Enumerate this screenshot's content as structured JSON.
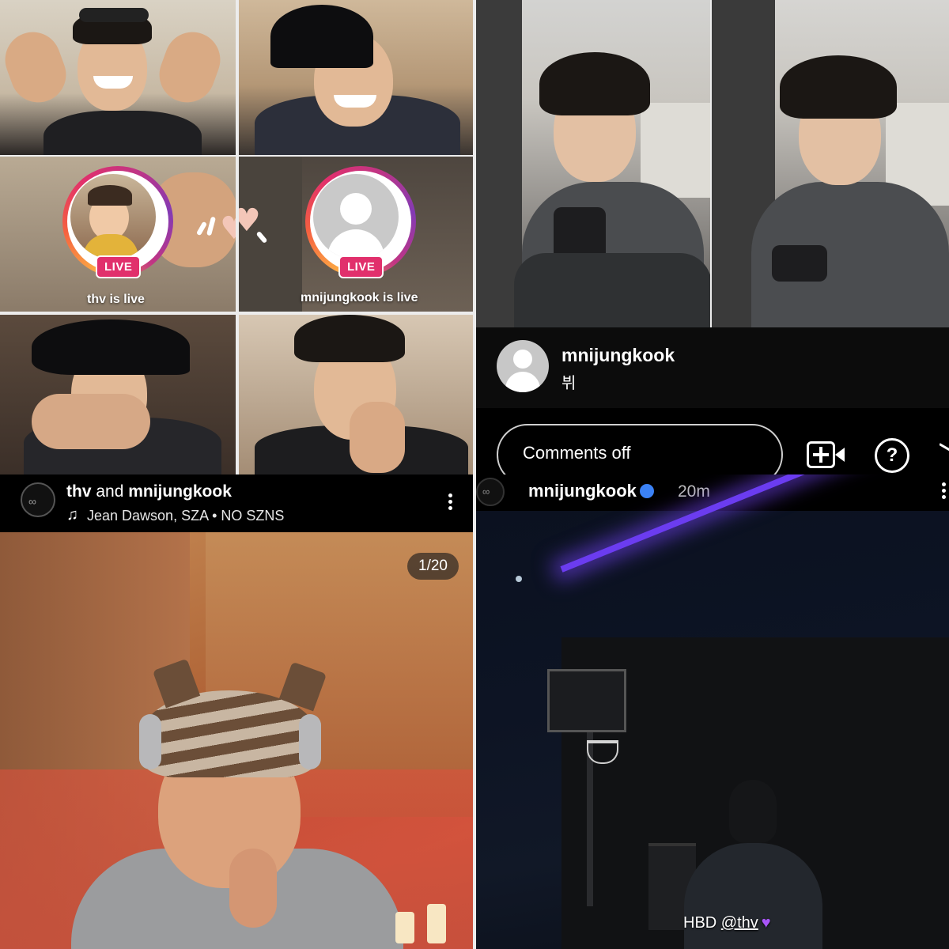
{
  "live_grid": {
    "left_live_caption": "thv is live",
    "right_live_caption": "mnijungkook is live",
    "left_live_badge": "LIVE",
    "right_live_badge": "LIVE"
  },
  "post_left": {
    "author_line_user1": "thv",
    "author_line_and": " and ",
    "author_line_user2": "mnijungkook",
    "music": "Jean Dawson, SZA • NO SZNS",
    "counter": "1/20"
  },
  "live_top_right": {
    "username": "mnijungkook",
    "subtitle": "뷔",
    "comments_label": "Comments off"
  },
  "post_right": {
    "username": "mnijungkook",
    "time": "20m",
    "caption_prefix": "HBD ",
    "caption_tag": "@thv",
    "caption_emoji": "💜"
  },
  "colors": {
    "live_pink": "#e1306c",
    "verified_blue": "#3b82f6"
  },
  "icons": [
    "music-note-icon",
    "more-options-icon",
    "verified-badge-icon",
    "add-video-icon",
    "question-icon",
    "send-icon",
    "profile-placeholder-icon"
  ]
}
